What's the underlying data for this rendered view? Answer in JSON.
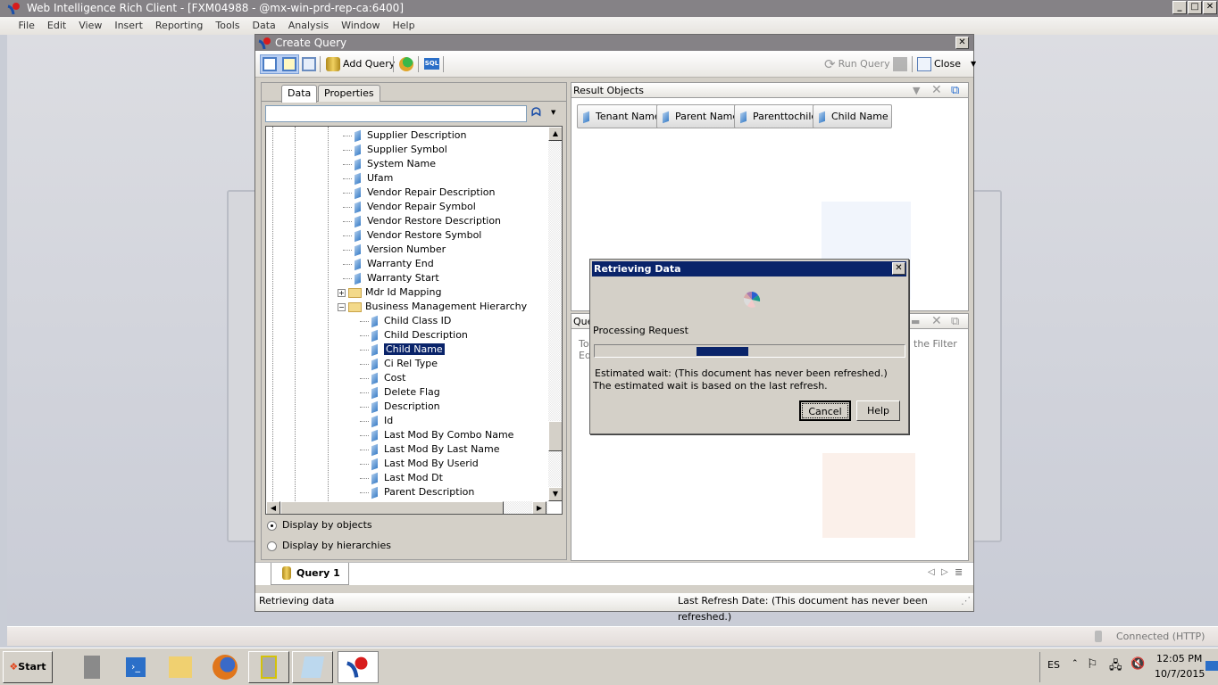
{
  "app": {
    "title": "Web Intelligence Rich Client - [FXM04988 - @mx-win-prd-rep-ca:6400]",
    "menu": [
      "File",
      "Edit",
      "View",
      "Insert",
      "Reporting",
      "Tools",
      "Data",
      "Analysis",
      "Window",
      "Help"
    ],
    "status": "Connected (HTTP)"
  },
  "create_query": {
    "title": "Create Query",
    "toolbar": {
      "add_query": "Add Query",
      "sql": "SQL",
      "run_query": "Run Query",
      "close": "Close"
    },
    "tabs": [
      "Data",
      "Properties"
    ],
    "search": {
      "value": "",
      "placeholder": ""
    },
    "tree": [
      {
        "label": "Supplier Description",
        "type": "object"
      },
      {
        "label": "Supplier Symbol",
        "type": "object"
      },
      {
        "label": "System Name",
        "type": "object"
      },
      {
        "label": "Ufam",
        "type": "object"
      },
      {
        "label": "Vendor Repair Description",
        "type": "object"
      },
      {
        "label": "Vendor Repair Symbol",
        "type": "object"
      },
      {
        "label": "Vendor Restore Description",
        "type": "object"
      },
      {
        "label": "Vendor Restore Symbol",
        "type": "object"
      },
      {
        "label": "Version Number",
        "type": "object"
      },
      {
        "label": "Warranty End",
        "type": "object"
      },
      {
        "label": "Warranty Start",
        "type": "object"
      },
      {
        "label": "Mdr Id Mapping",
        "type": "folder",
        "expanded": false
      },
      {
        "label": "Business Management Hierarchy",
        "type": "folder",
        "expanded": true
      },
      {
        "label": "Child Class ID",
        "type": "object"
      },
      {
        "label": "Child Description",
        "type": "object"
      },
      {
        "label": "Child Name",
        "type": "object",
        "selected": true
      },
      {
        "label": "Ci Rel Type",
        "type": "object"
      },
      {
        "label": "Cost",
        "type": "object"
      },
      {
        "label": "Delete Flag",
        "type": "object"
      },
      {
        "label": "Description",
        "type": "object"
      },
      {
        "label": "Id",
        "type": "object"
      },
      {
        "label": "Last Mod By Combo Name",
        "type": "object"
      },
      {
        "label": "Last Mod By Last Name",
        "type": "object"
      },
      {
        "label": "Last Mod By Userid",
        "type": "object"
      },
      {
        "label": "Last Mod Dt",
        "type": "object"
      },
      {
        "label": "Parent Description",
        "type": "object"
      }
    ],
    "display_options": [
      {
        "label": "Display by objects",
        "checked": true
      },
      {
        "label": "Display by hierarchies",
        "checked": false
      }
    ],
    "result_objects": {
      "title": "Result Objects",
      "items": [
        "Tenant Name",
        "Parent Name",
        "Parenttochild",
        "Child Name"
      ]
    },
    "query_filters": {
      "title": "Que",
      "hint_left_1": "To",
      "hint_left_2": "Ed",
      "hint_right": "the Filter"
    },
    "query_tab": "Query 1",
    "status_left": "Retrieving data",
    "status_right": "Last Refresh Date: (This document has never been refreshed.)"
  },
  "dialog": {
    "title": "Retrieving Data",
    "message": "Processing Request",
    "progress_marquee": {
      "start": 0.33,
      "end": 0.5
    },
    "estimate_1": "Estimated wait: (This document has never been refreshed.)",
    "estimate_2": "The estimated wait is based on the last refresh.",
    "cancel": "Cancel",
    "help": "Help"
  },
  "taskbar": {
    "start": "Start",
    "lang": "ES",
    "time": "12:05 PM",
    "date": "10/7/2015"
  },
  "colors": {
    "dialog_title": "#0a246a",
    "selection": "#0a246a",
    "titlebar": "#858286"
  }
}
